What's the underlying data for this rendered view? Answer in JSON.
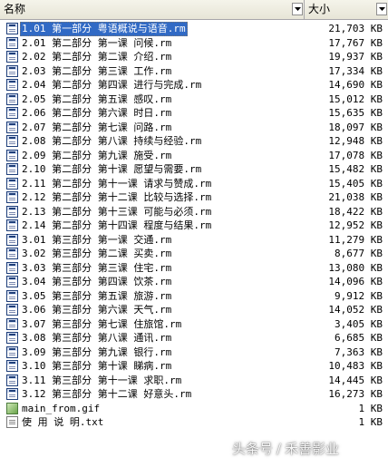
{
  "header": {
    "name_label": "名称",
    "size_label": "大小"
  },
  "files": [
    {
      "name": "1.01 第一部分 粤语概说与语音.rm",
      "size": "21,703 KB",
      "icon": "realmedia-file-icon"
    },
    {
      "name": "2.01 第二部分 第一课 问候.rm",
      "size": "17,767 KB",
      "icon": "realmedia-file-icon"
    },
    {
      "name": "2.02 第二部分 第二课 介绍.rm",
      "size": "19,937 KB",
      "icon": "realmedia-file-icon"
    },
    {
      "name": "2.03 第二部分 第三课 工作.rm",
      "size": "17,334 KB",
      "icon": "realmedia-file-icon"
    },
    {
      "name": "2.04 第二部分 第四课 进行与完成.rm",
      "size": "14,690 KB",
      "icon": "realmedia-file-icon"
    },
    {
      "name": "2.05 第二部分 第五课 感叹.rm",
      "size": "15,012 KB",
      "icon": "realmedia-file-icon"
    },
    {
      "name": "2.06 第二部分 第六课 时日.rm",
      "size": "15,635 KB",
      "icon": "realmedia-file-icon"
    },
    {
      "name": "2.07 第二部分 第七课 问路.rm",
      "size": "18,097 KB",
      "icon": "realmedia-file-icon"
    },
    {
      "name": "2.08 第二部分 第八课 持续与经验.rm",
      "size": "12,948 KB",
      "icon": "realmedia-file-icon"
    },
    {
      "name": "2.09 第二部分 第九课 施受.rm",
      "size": "17,078 KB",
      "icon": "realmedia-file-icon"
    },
    {
      "name": "2.10 第二部分 第十课 愿望与需要.rm",
      "size": "15,482 KB",
      "icon": "realmedia-file-icon"
    },
    {
      "name": "2.11 第二部分 第十一课 请求与赞成.rm",
      "size": "15,405 KB",
      "icon": "realmedia-file-icon"
    },
    {
      "name": "2.12 第二部分 第十二课 比较与选择.rm",
      "size": "21,038 KB",
      "icon": "realmedia-file-icon"
    },
    {
      "name": "2.13 第二部分 第十三课 可能与必须.rm",
      "size": "18,422 KB",
      "icon": "realmedia-file-icon"
    },
    {
      "name": "2.14 第二部分 第十四课 程度与结果.rm",
      "size": "12,952 KB",
      "icon": "realmedia-file-icon"
    },
    {
      "name": "3.01 第三部分 第一课 交通.rm",
      "size": "11,279 KB",
      "icon": "realmedia-file-icon"
    },
    {
      "name": "3.02 第三部分 第二课 买卖.rm",
      "size": "8,677 KB",
      "icon": "realmedia-file-icon"
    },
    {
      "name": "3.03 第三部分 第三课 住宅.rm",
      "size": "13,080 KB",
      "icon": "realmedia-file-icon"
    },
    {
      "name": "3.04 第三部分 第四课 饮茶.rm",
      "size": "14,096 KB",
      "icon": "realmedia-file-icon"
    },
    {
      "name": "3.05 第三部分 第五课 旅游.rm",
      "size": "9,912 KB",
      "icon": "realmedia-file-icon"
    },
    {
      "name": "3.06 第三部分 第六课 天气.rm",
      "size": "14,052 KB",
      "icon": "realmedia-file-icon"
    },
    {
      "name": "3.07 第三部分 第七课 住旅馆.rm",
      "size": "3,405 KB",
      "icon": "realmedia-file-icon"
    },
    {
      "name": "3.08 第三部分 第八课 通讯.rm",
      "size": "6,685 KB",
      "icon": "realmedia-file-icon"
    },
    {
      "name": "3.09 第三部分 第九课 银行.rm",
      "size": "7,363 KB",
      "icon": "realmedia-file-icon"
    },
    {
      "name": "3.10 第三部分 第十课 睇病.rm",
      "size": "10,483 KB",
      "icon": "realmedia-file-icon"
    },
    {
      "name": "3.11 第三部分 第十一课 求职.rm",
      "size": "14,445 KB",
      "icon": "realmedia-file-icon"
    },
    {
      "name": "3.12 第三部分 第十二课 好意头.rm",
      "size": "16,273 KB",
      "icon": "realmedia-file-icon"
    },
    {
      "name": "main_from.gif",
      "size": "1 KB",
      "icon": "gif-image-icon"
    },
    {
      "name": "使 用 说 明.txt",
      "size": "1 KB",
      "icon": "text-file-icon"
    }
  ],
  "watermark": {
    "left": "头条号",
    "separator": "/",
    "right": "禾善影业"
  }
}
